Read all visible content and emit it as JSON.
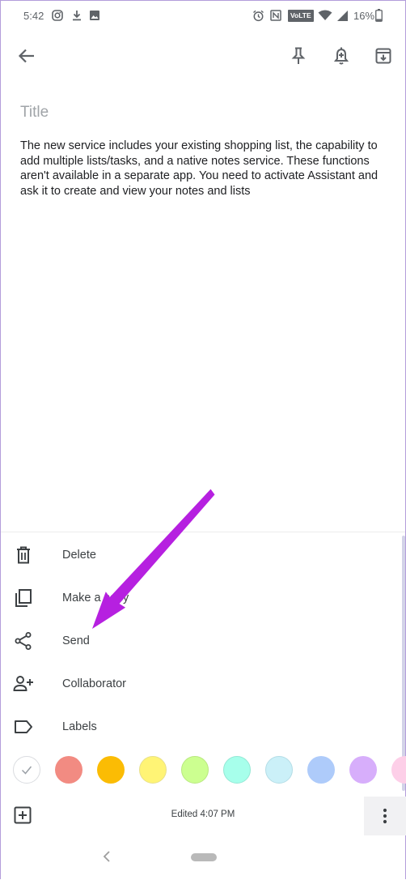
{
  "status_bar": {
    "time": "5:42",
    "volte": "VoLTE",
    "battery": "16%"
  },
  "toolbar": {
    "back": "arrow-back-icon",
    "pin": "pin-icon",
    "reminder": "reminder-bell-icon",
    "archive": "archive-icon"
  },
  "note": {
    "title_placeholder": "Title",
    "body": "The new service includes your existing shopping list, the capability to add multiple lists/tasks, and a native notes service. These functions aren't available in a separate app. You need to activate Assistant and ask it to create and view your notes and lists"
  },
  "menu": {
    "items": [
      {
        "label": "Delete",
        "icon": "trash-icon"
      },
      {
        "label": "Make a copy",
        "icon": "copy-icon"
      },
      {
        "label": "Send",
        "icon": "share-icon"
      },
      {
        "label": "Collaborator",
        "icon": "person-add-icon"
      },
      {
        "label": "Labels",
        "icon": "label-icon"
      }
    ]
  },
  "colors": [
    "#ffffff",
    "#f28b82",
    "#fbbc04",
    "#fff475",
    "#ccff90",
    "#a7ffeb",
    "#cbf0f8",
    "#aecbfa",
    "#d7aefb",
    "#fdcfe8"
  ],
  "bottom_bar": {
    "edited": "Edited 4:07 PM"
  },
  "annotation": {
    "arrow_color": "#b620e0"
  }
}
